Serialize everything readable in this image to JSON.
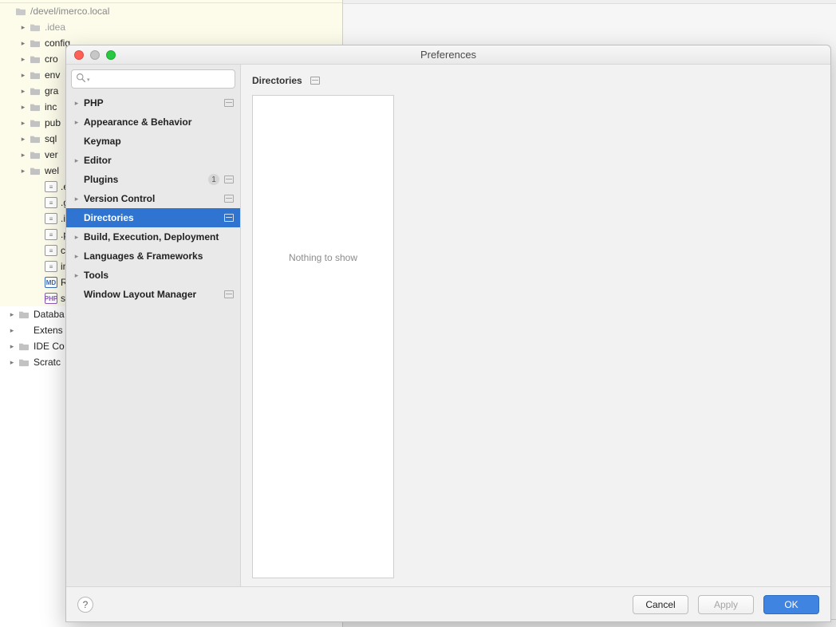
{
  "project_tree": {
    "root_path": "/devel/imerco.local",
    "highlight_items": [
      {
        "label": ".idea",
        "icon": "folder",
        "indent": 1,
        "dim": true,
        "expandable": true
      },
      {
        "label": "config",
        "icon": "folder",
        "indent": 1,
        "dim": false,
        "expandable": true
      },
      {
        "label": "cro",
        "icon": "folder",
        "indent": 1,
        "dim": false,
        "expandable": true
      },
      {
        "label": "env",
        "icon": "folder",
        "indent": 1,
        "dim": false,
        "expandable": true
      },
      {
        "label": "gra",
        "icon": "folder",
        "indent": 1,
        "dim": false,
        "expandable": true
      },
      {
        "label": "inc",
        "icon": "folder",
        "indent": 1,
        "dim": false,
        "expandable": true
      },
      {
        "label": "pub",
        "icon": "folder",
        "indent": 1,
        "dim": false,
        "expandable": true
      },
      {
        "label": "sql",
        "icon": "folder",
        "indent": 1,
        "dim": false,
        "expandable": true
      },
      {
        "label": "ver",
        "icon": "folder",
        "indent": 1,
        "dim": false,
        "expandable": true
      },
      {
        "label": "wel",
        "icon": "folder",
        "indent": 1,
        "dim": false,
        "expandable": true
      },
      {
        "label": ".en",
        "icon": "file-txt",
        "indent": 2,
        "dim": false,
        "expandable": false
      },
      {
        "label": ".git",
        "icon": "file-txt",
        "indent": 2,
        "dim": false,
        "expandable": false
      },
      {
        "label": ".ign",
        "icon": "file-txt",
        "indent": 2,
        "dim": false,
        "expandable": false
      },
      {
        "label": ".pe",
        "icon": "file-txt",
        "indent": 2,
        "dim": false,
        "expandable": false
      },
      {
        "label": "cor",
        "icon": "file-txt",
        "indent": 2,
        "dim": false,
        "expandable": false
      },
      {
        "label": "ins",
        "icon": "file-txt",
        "indent": 2,
        "dim": false,
        "expandable": false
      },
      {
        "label": "RE",
        "icon": "file-md",
        "indent": 2,
        "dim": false,
        "expandable": false
      },
      {
        "label": "set",
        "icon": "file-php",
        "indent": 2,
        "dim": false,
        "expandable": false
      }
    ],
    "plain_items": [
      {
        "label": "Databa",
        "icon": "folder",
        "indent": 0,
        "expandable": true
      },
      {
        "label": "Extens",
        "icon": "none",
        "indent": 0,
        "expandable": true
      },
      {
        "label": "IDE Co",
        "icon": "folder",
        "indent": 0,
        "expandable": true
      },
      {
        "label": "Scratc",
        "icon": "folder",
        "indent": 0,
        "expandable": true
      }
    ]
  },
  "dialog": {
    "title": "Preferences",
    "search_placeholder": "",
    "nav": [
      {
        "label": "PHP",
        "expandable": true,
        "selected": false,
        "badge": null,
        "proj": true
      },
      {
        "label": "Appearance & Behavior",
        "expandable": true,
        "selected": false,
        "badge": null,
        "proj": false
      },
      {
        "label": "Keymap",
        "expandable": false,
        "selected": false,
        "badge": null,
        "proj": false
      },
      {
        "label": "Editor",
        "expandable": true,
        "selected": false,
        "badge": null,
        "proj": false
      },
      {
        "label": "Plugins",
        "expandable": false,
        "selected": false,
        "badge": "1",
        "proj": true
      },
      {
        "label": "Version Control",
        "expandable": true,
        "selected": false,
        "badge": null,
        "proj": true
      },
      {
        "label": "Directories",
        "expandable": false,
        "selected": true,
        "badge": null,
        "proj": true
      },
      {
        "label": "Build, Execution, Deployment",
        "expandable": true,
        "selected": false,
        "badge": null,
        "proj": false
      },
      {
        "label": "Languages & Frameworks",
        "expandable": true,
        "selected": false,
        "badge": null,
        "proj": false
      },
      {
        "label": "Tools",
        "expandable": true,
        "selected": false,
        "badge": null,
        "proj": false
      },
      {
        "label": "Window Layout Manager",
        "expandable": false,
        "selected": false,
        "badge": null,
        "proj": true
      }
    ],
    "breadcrumb": "Directories",
    "empty_text": "Nothing to show",
    "buttons": {
      "help": "?",
      "cancel": "Cancel",
      "apply": "Apply",
      "ok": "OK"
    }
  }
}
